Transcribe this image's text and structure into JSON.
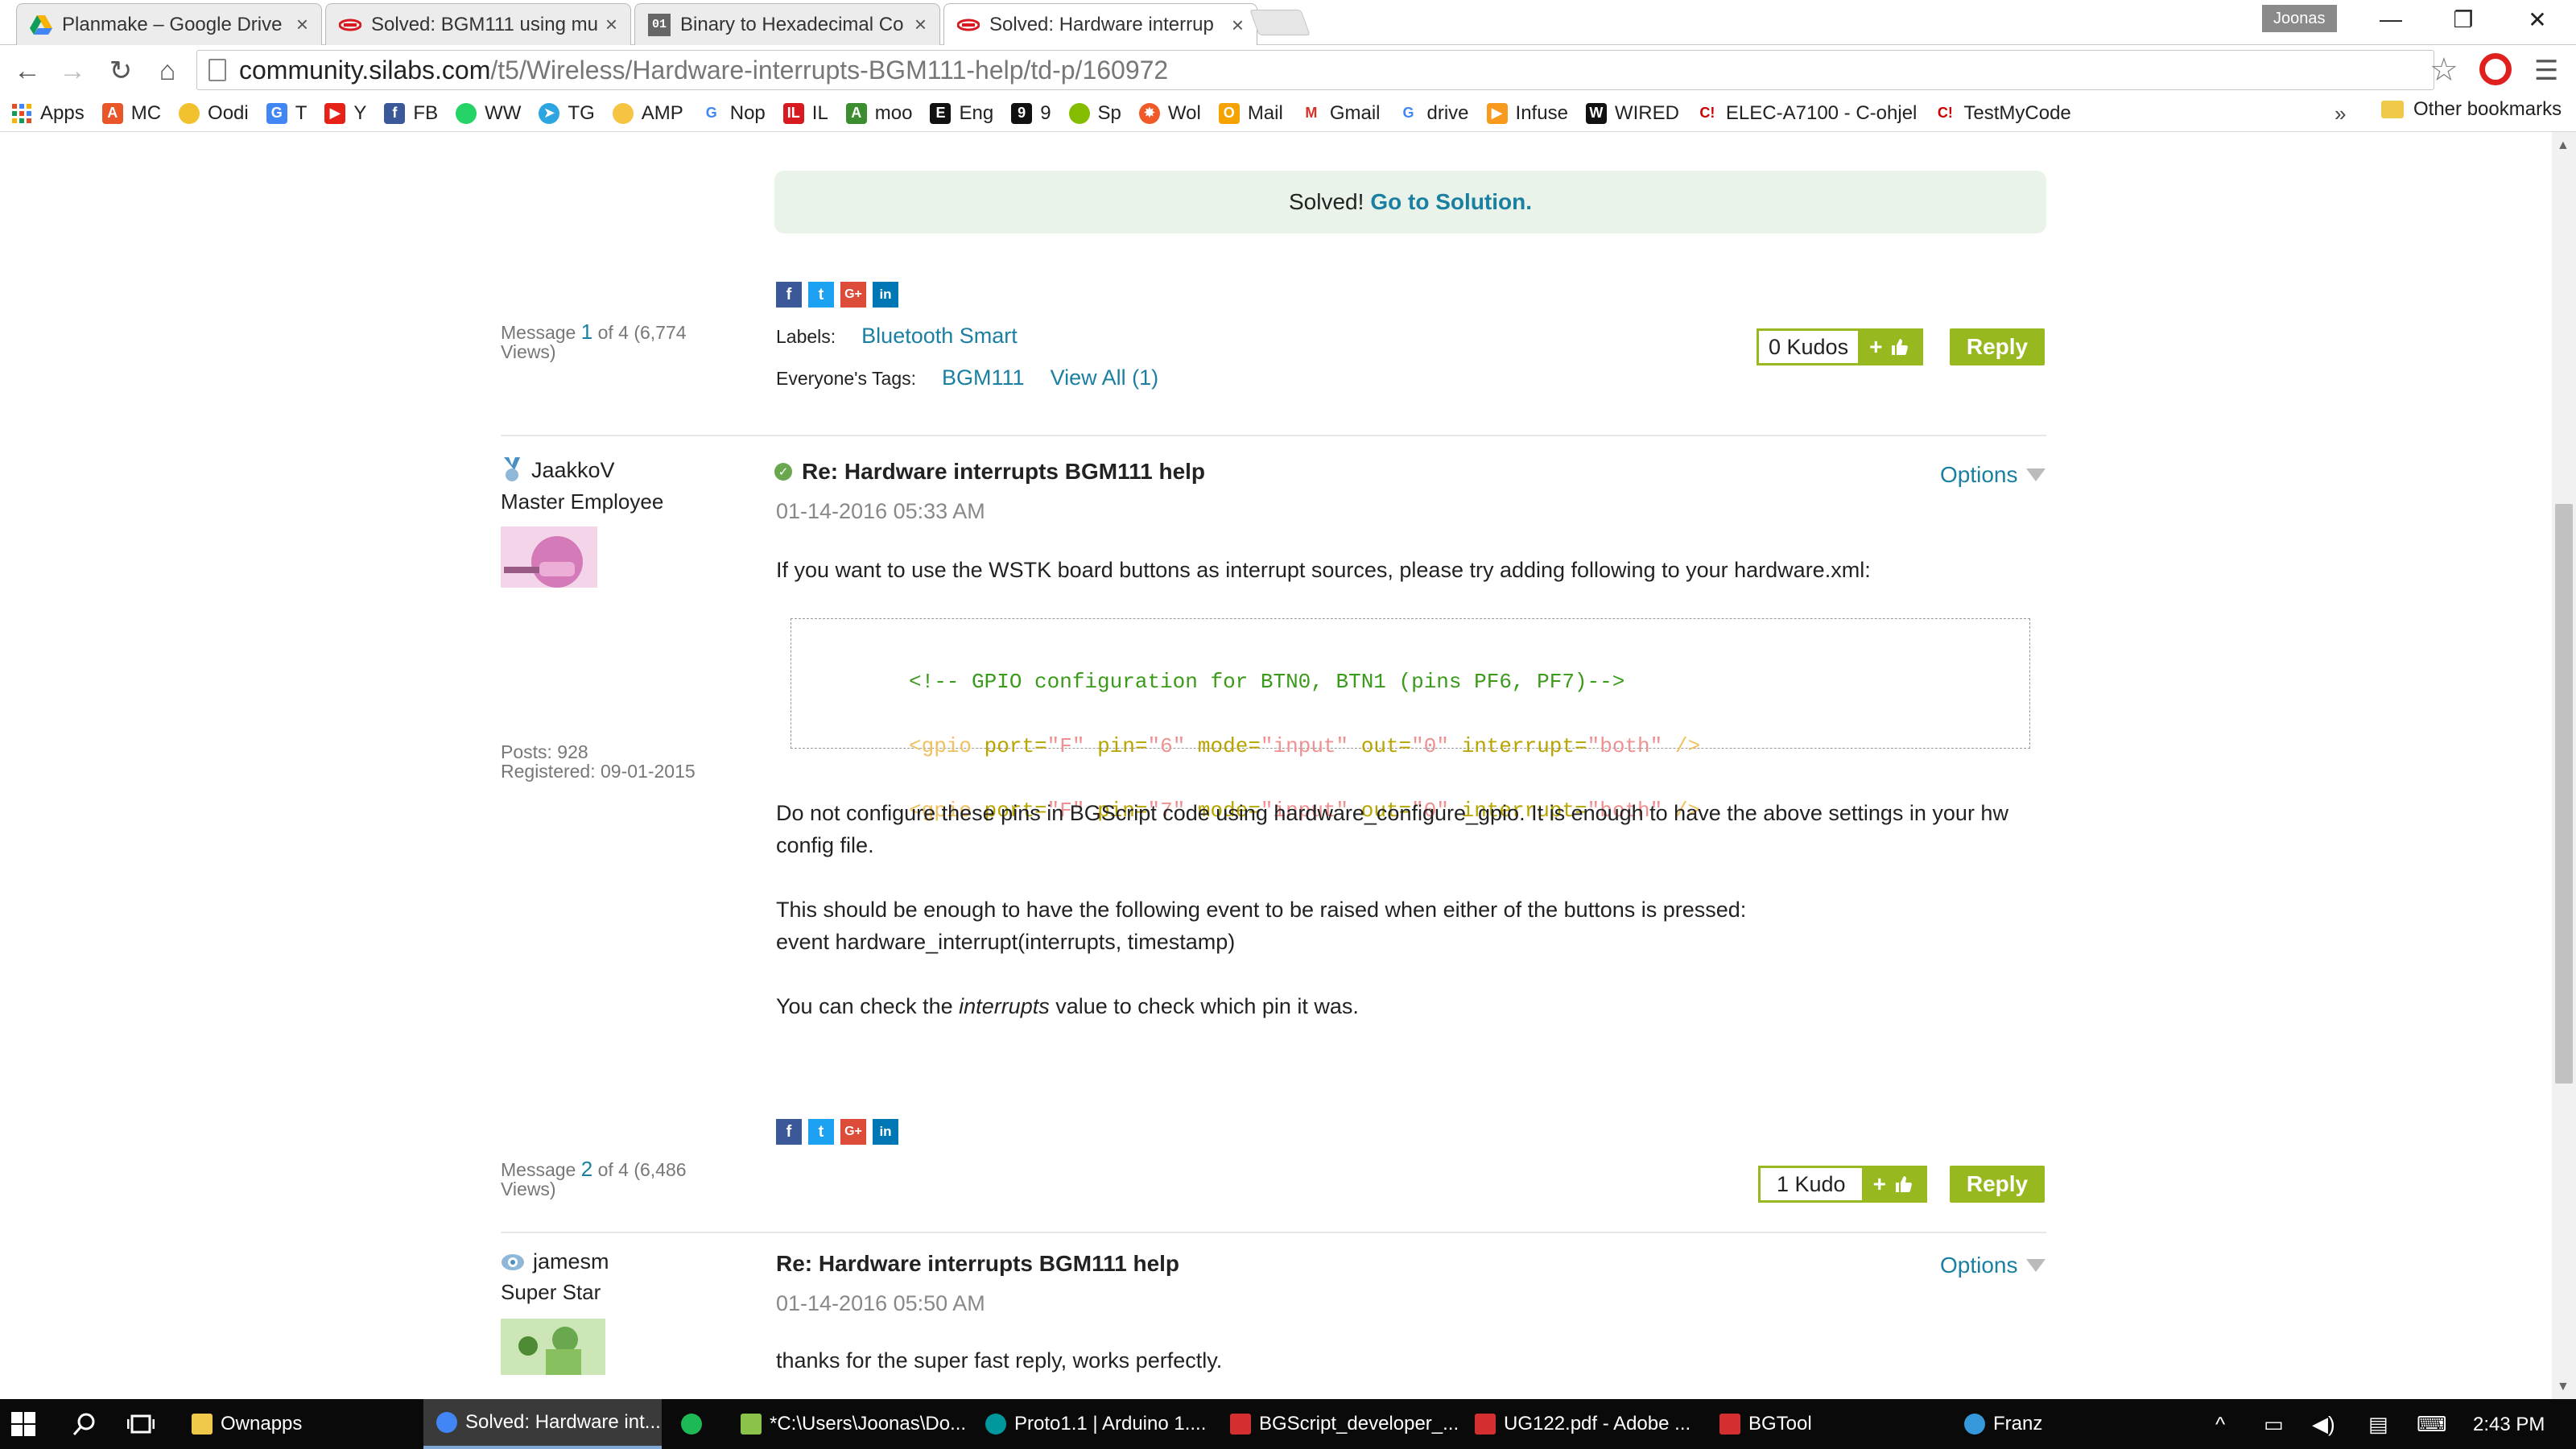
{
  "browser": {
    "tabs": [
      {
        "title": "Planmake – Google Drive",
        "close": "×"
      },
      {
        "title": "Solved: BGM111 using mu",
        "close": "×"
      },
      {
        "title": "Binary to Hexadecimal Co",
        "close": "×"
      },
      {
        "title": "Solved: Hardware interrup",
        "close": "×"
      }
    ],
    "profile_name": "Joonas",
    "window_controls": {
      "minimize": "—",
      "restore": "❐",
      "close": "✕"
    },
    "nav": {
      "back": "←",
      "forward": "→",
      "reload": "↻",
      "home": "⌂"
    },
    "url_host": "community.silabs.com",
    "url_path": "/t5/Wireless/Hardware-interrupts-BGM111-help/td-p/160972",
    "star": "☆",
    "menu": "☰"
  },
  "bookmarks": {
    "items": [
      {
        "label": "Apps",
        "icon": "apps-grid-icon",
        "color": "#e44d26"
      },
      {
        "label": "MC",
        "icon": "mc-icon",
        "color": "#e8562a"
      },
      {
        "label": "Oodi",
        "icon": "oodi-icon",
        "color": "#f2c12e"
      },
      {
        "label": "T",
        "icon": "translate-icon",
        "color": "#4285f4"
      },
      {
        "label": "Y",
        "icon": "youtube-icon",
        "color": "#e62117"
      },
      {
        "label": "FB",
        "icon": "facebook-icon",
        "color": "#3b5998"
      },
      {
        "label": "WW",
        "icon": "whatsapp-icon",
        "color": "#25d366"
      },
      {
        "label": "TG",
        "icon": "telegram-icon",
        "color": "#2ca5e0"
      },
      {
        "label": "AMP",
        "icon": "amp-icon",
        "color": "#f6c342"
      },
      {
        "label": "Nop",
        "icon": "google-icon",
        "color": "#4285f4"
      },
      {
        "label": "IL",
        "icon": "il-icon",
        "color": "#d71920"
      },
      {
        "label": "moo",
        "icon": "moodle-icon",
        "color": "#3c8d2f"
      },
      {
        "label": "Eng",
        "icon": "eng-icon",
        "color": "#111111"
      },
      {
        "label": "9",
        "icon": "ninegag-icon",
        "color": "#111111"
      },
      {
        "label": "Sp",
        "icon": "spotify-icon",
        "color": "#84bd00"
      },
      {
        "label": "Wol",
        "icon": "wolfram-icon",
        "color": "#f05a28"
      },
      {
        "label": "Mail",
        "icon": "office-mail-icon",
        "color": "#f4a300"
      },
      {
        "label": "Gmail",
        "icon": "gmail-icon",
        "color": "#d93025"
      },
      {
        "label": "drive",
        "icon": "google-drive-icon",
        "color": "#4285f4"
      },
      {
        "label": "Infuse",
        "icon": "infuse-icon",
        "color": "#f79a1e"
      },
      {
        "label": "WIRED",
        "icon": "wired-icon",
        "color": "#111111"
      },
      {
        "label": "ELEC-A7100 - C-ohjel",
        "icon": "course-icon",
        "color": "#cc0000"
      },
      {
        "label": "TestMyCode",
        "icon": "testmycode-icon",
        "color": "#cc0000"
      }
    ],
    "overflow": "»",
    "other": "Other bookmarks"
  },
  "page": {
    "solved_prefix": "Solved!",
    "solved_link": "Go to Solution.",
    "message1": {
      "prefix": "Message",
      "number": "1",
      "suffix": "of 4 (6,774 Views)",
      "labels_label": "Labels:",
      "labels_value": "Bluetooth Smart",
      "tags_label": "Everyone's Tags:",
      "tag": "BGM111",
      "view_all": "View All (1)",
      "kudos": "0 Kudos",
      "reply": "Reply"
    },
    "post2": {
      "author": "JaakkoV",
      "rank": "Master Employee",
      "posts": "Posts: 928",
      "registered": "Registered: 09-01-2015",
      "title": "Re: Hardware interrupts BGM111 help",
      "date": "01-14-2016 05:33 AM",
      "options": "Options",
      "intro": "If you want to use the WSTK board buttons as interrupt sources, please try adding following to your hardware.xml:",
      "code_comment": "<!-- GPIO configuration for BTN0, BTN1 (pins PF6, PF7)-->",
      "code_lines": [
        {
          "port": "\"F\"",
          "pin": "\"6\"",
          "mode": "\"input\"",
          "out": "\"0\"",
          "interrupt": "\"both\""
        },
        {
          "port": "\"F\"",
          "pin": "\"7\"",
          "mode": "\"input\"",
          "out": "\"0\"",
          "interrupt": "\"both\""
        }
      ],
      "para1": "Do not configure these pins in BGScript code using hardware_configure_gpio. It is enough to have the above settings in your hw config file.",
      "para2_line1": "This should be enough to have the following event to be raised when either of the buttons is pressed:",
      "para2_line2": "event hardware_interrupt(interrupts, timestamp)",
      "para3_pre": "You can check the ",
      "para3_em": "interrupts",
      "para3_post": " value to check which pin it was.",
      "message_prefix": "Message",
      "message_number": "2",
      "message_suffix": "of 4 (6,486 Views)",
      "kudos": "1 Kudo",
      "reply": "Reply"
    },
    "post3": {
      "author": "jamesm",
      "rank": "Super Star",
      "title": "Re: Hardware interrupts BGM111 help",
      "date": "01-14-2016 05:50 AM",
      "options": "Options",
      "text": "thanks for the super fast reply, works perfectly."
    }
  },
  "taskbar": {
    "items": [
      {
        "label": "Ownapps",
        "icon": "folder-icon",
        "color": "#f0c84a"
      },
      {
        "label": "Solved: Hardware int...",
        "icon": "chrome-icon",
        "color": "#4285f4"
      },
      {
        "label": "",
        "icon": "spotify-icon",
        "color": "#1db954"
      },
      {
        "label": "*C:\\Users\\Joonas\\Do...",
        "icon": "notepad-icon",
        "color": "#8bc34a"
      },
      {
        "label": "Proto1.1 | Arduino 1....",
        "icon": "arduino-icon",
        "color": "#00979d"
      },
      {
        "label": "BGScript_developer_...",
        "icon": "pdf-icon",
        "color": "#d32f2f"
      },
      {
        "label": "UG122.pdf - Adobe ...",
        "icon": "acrobat-icon",
        "color": "#d32f2f"
      },
      {
        "label": "BGTool",
        "icon": "bgtool-icon",
        "color": "#d32f2f"
      },
      {
        "label": "Franz",
        "icon": "franz-icon",
        "color": "#3498db"
      }
    ],
    "time": "2:43 PM"
  }
}
